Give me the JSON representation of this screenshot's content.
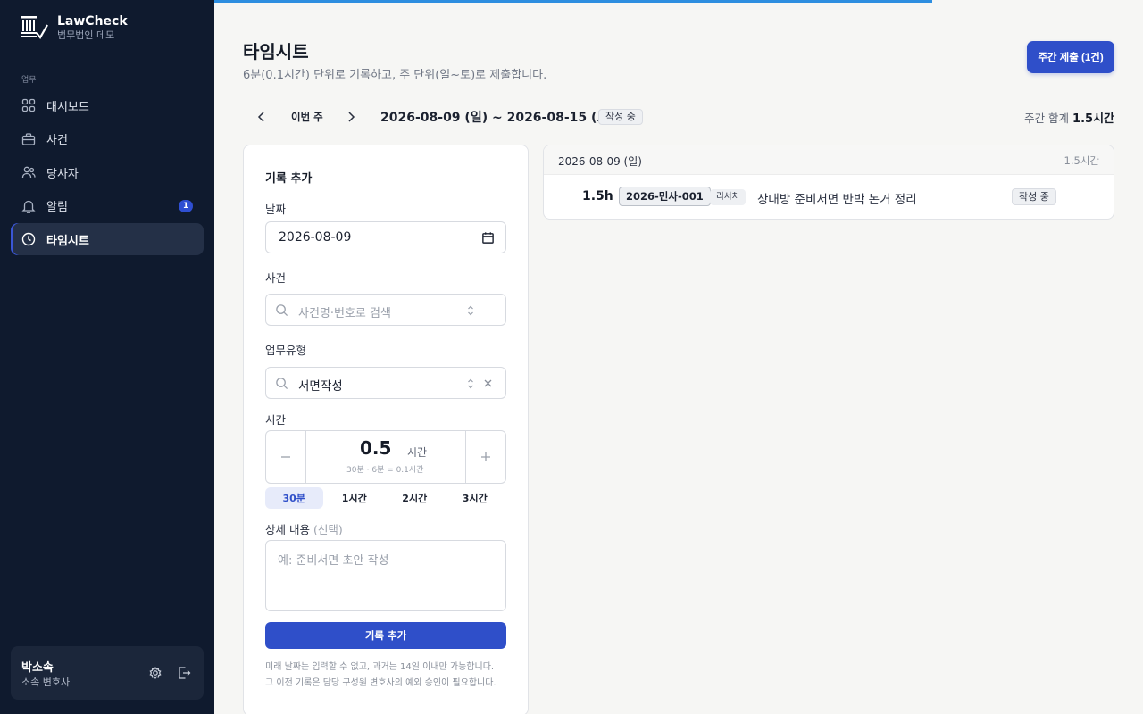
{
  "brand": {
    "name": "LawCheck",
    "subtitle": "법무법인 데모"
  },
  "sidebar": {
    "section_label": "업무",
    "items": [
      {
        "label": "대시보드",
        "icon": "grid-icon"
      },
      {
        "label": "사건",
        "icon": "briefcase-icon"
      },
      {
        "label": "당사자",
        "icon": "users-icon"
      },
      {
        "label": "알림",
        "icon": "bell-icon",
        "badge": "1"
      },
      {
        "label": "타임시트",
        "icon": "clock-icon",
        "active": true
      }
    ]
  },
  "user": {
    "name": "박소속",
    "role": "소속 변호사"
  },
  "header": {
    "title": "타임시트",
    "subtitle": "6분(0.1시간) 단위로 기록하고, 주 단위(일~토)로 제출합니다.",
    "submit_label": "주간 제출 (1건)"
  },
  "week": {
    "this_week_label": "이번 주",
    "range": "2026-08-09 (일) ~ 2026-08-15 (토)",
    "status": "작성 중",
    "total_label": "주간 합계",
    "total_value": "1.5시간"
  },
  "form": {
    "title": "기록 추가",
    "date_label": "날짜",
    "date_value": "2026-08-09",
    "case_label": "사건",
    "case_placeholder": "사건명·번호로 검색",
    "worktype_label": "업무유형",
    "worktype_value": "서면작성",
    "time_label": "시간",
    "time_value": "0.5",
    "time_unit": "시간",
    "time_hint": "30분 · 6분 = 0.1시간",
    "quick_options": [
      "30분",
      "1시간",
      "2시간",
      "3시간"
    ],
    "quick_selected": "30분",
    "detail_label": "상세 내용",
    "detail_optional": "(선택)",
    "detail_placeholder": "예: 준비서면 초안 작성",
    "add_label": "기록 추가",
    "note_line1": "미래 날짜는 입력할 수 없고, 과거는 14일 이내만 가능합니다.",
    "note_line2": "그 이전 기록은 담당 구성원 변호사의 예외 승인이 필요합니다."
  },
  "entries": {
    "day_date": "2026-08-09 (일)",
    "day_total": "1.5시간",
    "rows": [
      {
        "hours": "1.5h",
        "case": "2026-민사-001",
        "type": "리서치",
        "description": "상대방 준비서면 반박 논거 정리",
        "status": "작성 중"
      }
    ]
  },
  "colors": {
    "sidebar_bg": "#0f1a2e",
    "accent": "#2f4fc9",
    "progress": "#2d8ee0"
  }
}
